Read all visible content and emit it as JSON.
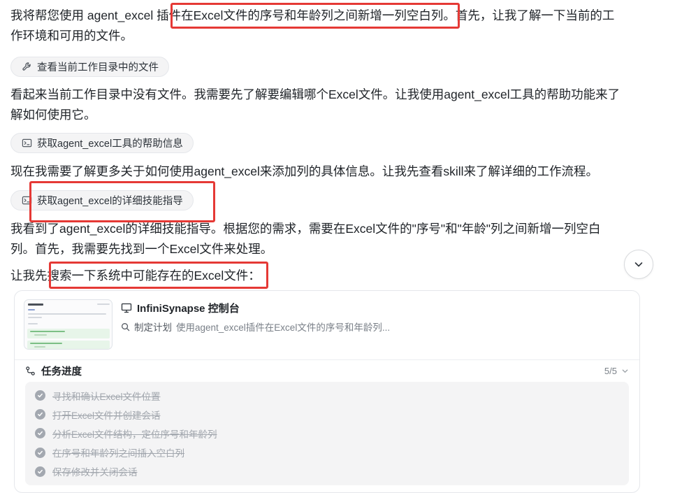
{
  "messages": {
    "p1_line1": "我将帮您使用 agent_excel 插件在Excel文件的序号和年龄列之间新增一列空白列。首先，让我了解一下当前的工",
    "p1_line2": "作环境和可用的文件。",
    "p2_line1": "看起来当前工作目录中没有文件。我需要先了解要编辑哪个Excel文件。让我使用agent_excel工具的帮助功能来了",
    "p2_line2": "解如何使用它。",
    "p3": "现在我需要了解更多关于如何使用agent_excel来添加列的具体信息。让我先查看skill来了解详细的工作流程。",
    "p4_line1": "我看到了agent_excel的详细技能指导。根据您的需求，需要在Excel文件的\"序号\"和\"年龄\"列之间新增一列空白",
    "p4_line2": "列。首先，我需要先找到一个Excel文件来处理。",
    "p5": "让我先搜索一下系统中可能存在的Excel文件："
  },
  "tool_calls": {
    "list_dir": {
      "label": "查看当前工作目录中的文件",
      "icon": "wrench-icon"
    },
    "help": {
      "label": "获取agent_excel工具的帮助信息",
      "icon": "terminal-icon"
    },
    "skill": {
      "label": "获取agent_excel的详细技能指导",
      "icon": "terminal-icon"
    }
  },
  "task_card": {
    "app_name": "InfiniSynapse 控制台",
    "app_icon": "monitor-icon",
    "plan_label": "制定计划",
    "plan_task": "使用agent_excel插件在Excel文件的序号和年龄列...",
    "progress_title": "任务进度",
    "progress_count": "5/5",
    "steps": [
      "寻找和确认Excel文件位置",
      "打开Excel文件并创建会话",
      "分析Excel文件结构，定位序号和年龄列",
      "在序号和年龄列之间插入空白列",
      "保存修改并关闭会话"
    ]
  },
  "colors": {
    "highlight": "#e53935",
    "chip_bg": "#f4f4f5",
    "done_check": "#a3a8b0",
    "done_text": "#a2a7ae"
  }
}
